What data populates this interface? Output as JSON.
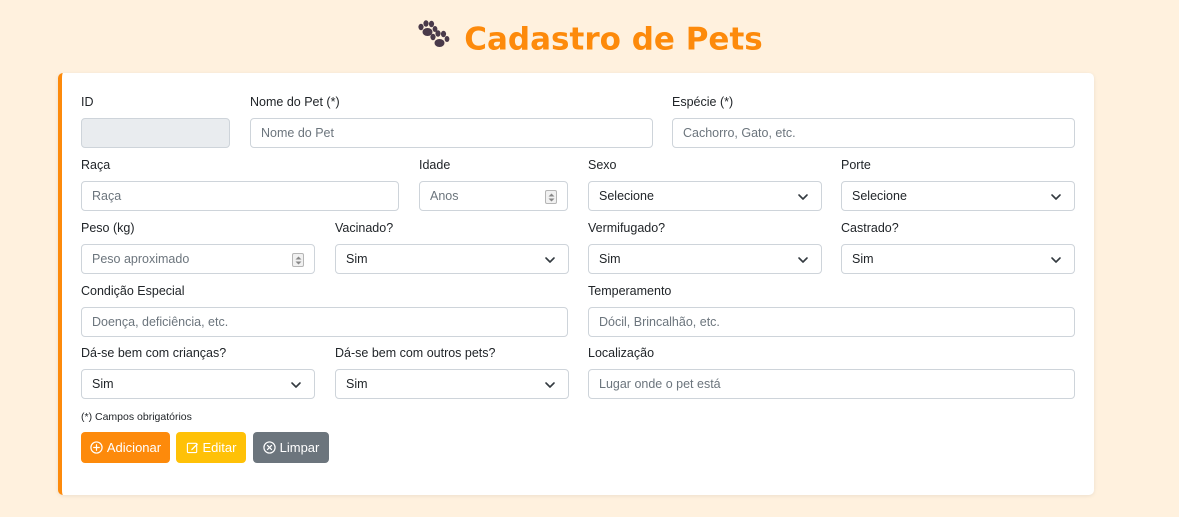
{
  "header": {
    "title": "Cadastro de Pets",
    "icon": "paw-icon",
    "title_color": "#fd8a0b"
  },
  "form": {
    "id": {
      "label": "ID",
      "value": ""
    },
    "nome": {
      "label": "Nome do Pet (*)",
      "placeholder": "Nome do Pet"
    },
    "especie": {
      "label": "Espécie (*)",
      "placeholder": "Cachorro, Gato, etc."
    },
    "raca": {
      "label": "Raça",
      "placeholder": "Raça"
    },
    "idade": {
      "label": "Idade",
      "placeholder": "Anos"
    },
    "sexo": {
      "label": "Sexo",
      "value": "Selecione"
    },
    "porte": {
      "label": "Porte",
      "value": "Selecione"
    },
    "peso": {
      "label": "Peso (kg)",
      "placeholder": "Peso aproximado"
    },
    "vacinado": {
      "label": "Vacinado?",
      "value": "Sim"
    },
    "vermifugado": {
      "label": "Vermifugado?",
      "value": "Sim"
    },
    "castrado": {
      "label": "Castrado?",
      "value": "Sim"
    },
    "condicao": {
      "label": "Condição Especial",
      "placeholder": "Doença, deficiência, etc."
    },
    "temperamento": {
      "label": "Temperamento",
      "placeholder": "Dócil, Brincalhão, etc."
    },
    "criancas": {
      "label": "Dá-se bem com crianças?",
      "value": "Sim"
    },
    "outros_pets": {
      "label": "Dá-se bem com outros pets?",
      "value": "Sim"
    },
    "localizacao": {
      "label": "Localização",
      "placeholder": "Lugar onde o pet está"
    },
    "required_note": "(*) Campos obrigatórios"
  },
  "buttons": {
    "add": {
      "label": "Adicionar",
      "icon": "plus-circle-icon",
      "color": "#fd8a0b"
    },
    "edit": {
      "label": "Editar",
      "icon": "pencil-square-icon",
      "color": "#ffc107"
    },
    "clear": {
      "label": "Limpar",
      "icon": "x-circle-icon",
      "color": "#6c757d"
    }
  }
}
